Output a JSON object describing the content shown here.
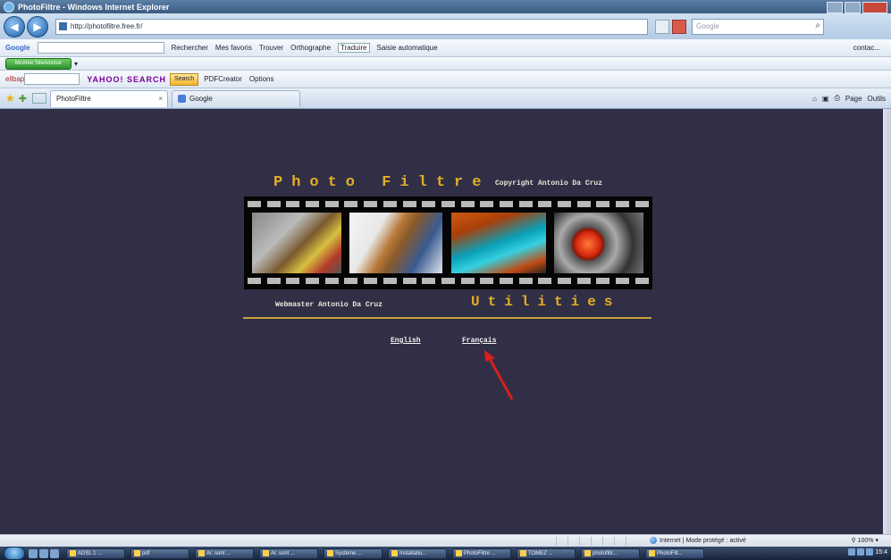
{
  "window": {
    "title": "PhotoFiltre - Windows Internet Explorer"
  },
  "address_bar": {
    "url": "http://photofiltre.free.fr/",
    "search_placeholder": "Google"
  },
  "google_toolbar": {
    "logo": "Google",
    "items": [
      "Rechercher",
      "Mes favoris",
      "Trouver",
      "Orthographe",
      "Traduire",
      "Saisie automatique"
    ],
    "right": "contac..."
  },
  "mcafee_toolbar": {
    "button": "McAfee SiteAdvisor"
  },
  "yahoo_toolbar": {
    "prefix": "ellbap",
    "logo": "YAHOO! SEARCH",
    "search_button": "Search",
    "items": [
      "PDFCreator",
      "Options"
    ]
  },
  "tabs": [
    {
      "label": "PhotoFiltre",
      "active": true
    },
    {
      "label": "Google",
      "active": false
    }
  ],
  "command_bar": {
    "items": [
      "Page",
      "Outils"
    ]
  },
  "page": {
    "title": "Photo Filtre",
    "copyright": "Copyright Antonio Da Cruz",
    "webmaster": "Webmaster Antonio Da Cruz",
    "utilities": "Utilities",
    "links": {
      "english": "English",
      "francais": "Français"
    }
  },
  "status_bar": {
    "zone": "Internet | Mode protégé : activé",
    "zoom": "100%"
  },
  "taskbar": {
    "buttons": [
      "ADSL 1 ...",
      "pdf",
      "Ar. sont ...",
      "Ar. sont ...",
      "Système ...",
      "Installatio...",
      "PhotoFiltre ...",
      "TOMEZ ...",
      "photofiltr...",
      "PhotoFilt..."
    ],
    "clock": "15:4"
  },
  "colors": {
    "page_background": "#302f46",
    "accent_gold": "#e3ad28"
  }
}
